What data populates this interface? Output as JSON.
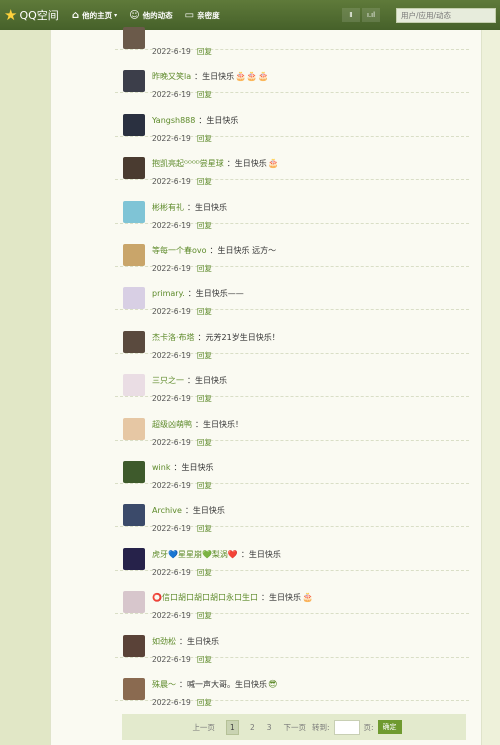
{
  "topbar": {
    "logo": "QQ空间",
    "nav": [
      "他的主页",
      "他的动态",
      "亲密度"
    ],
    "nav_caret": "▾",
    "btn1": "Ⅱ",
    "btn2": "ı.ıl",
    "search_placeholder": "用户/应用/动态"
  },
  "comments": [
    {
      "name": "",
      "content": "",
      "date": "2022-6-19",
      "reply": "回复",
      "avatar_color": "#6b5a4a",
      "emojis": ""
    },
    {
      "name": "昨晚又笑la",
      "content": "：生日快乐",
      "date": "2022-6-19",
      "reply": "回复",
      "avatar_color": "#3c3e4a",
      "emojis": "🎂🎂🎂"
    },
    {
      "name": "Yangsh888",
      "content": "：生日快乐",
      "date": "2022-6-19",
      "reply": "回复",
      "avatar_color": "#2a3040",
      "emojis": ""
    },
    {
      "name": "抱凯亮起ᴳᴼᴼᴰ尝星球",
      "content": "：生日快乐",
      "date": "2022-6-19",
      "reply": "回复",
      "avatar_color": "#4a3b30",
      "emojis": "🎂"
    },
    {
      "name": "彬彬有礼",
      "content": "：生日快乐",
      "date": "2022-6-19",
      "reply": "回复",
      "avatar_color": "#7fc4d6",
      "emojis": ""
    },
    {
      "name": "等每一个春ovo",
      "content": "：生日快乐 远方～",
      "date": "2022-6-19",
      "reply": "回复",
      "avatar_color": "#c9a56a",
      "emojis": ""
    },
    {
      "name": "primary.",
      "content": "：生日快乐——",
      "date": "2022-6-19",
      "reply": "回复",
      "avatar_color": "#d8cfe4",
      "emojis": ""
    },
    {
      "name": "杰卡洛·布塔",
      "content": "：元芳21岁生日快乐！",
      "date": "2022-6-19",
      "reply": "回复",
      "avatar_color": "#5a4a3e",
      "emojis": ""
    },
    {
      "name": "三只之一",
      "content": "：生日快乐",
      "date": "2022-6-19",
      "reply": "回复",
      "avatar_color": "#eadde4",
      "emojis": ""
    },
    {
      "name": "超级凶萌鸭",
      "content": "：生日快乐！",
      "date": "2022-6-19",
      "reply": "回复",
      "avatar_color": "#e6c7a4",
      "emojis": ""
    },
    {
      "name": "wink",
      "content": "：生日快乐",
      "date": "2022-6-19",
      "reply": "回复",
      "avatar_color": "#3e5a2c",
      "emojis": ""
    },
    {
      "name": "Archive",
      "content": "：生日快乐",
      "date": "2022-6-19",
      "reply": "回复",
      "avatar_color": "#3b4a6a",
      "emojis": ""
    },
    {
      "name": "虎牙💙星星崩💚梨涡❤️",
      "content": "：生日快乐",
      "date": "2022-6-19",
      "reply": "回复",
      "avatar_color": "#26224a",
      "emojis": ""
    },
    {
      "name": "⭕信口胡口胡口胡口永口生口",
      "content": "：生日快乐",
      "date": "2022-6-19",
      "reply": "回复",
      "avatar_color": "#d7c6cc",
      "emojis": "🎂"
    },
    {
      "name": "如劲松",
      "content": "：生日快乐",
      "date": "2022-6-19",
      "reply": "回复",
      "avatar_color": "#5a4238",
      "emojis": ""
    },
    {
      "name": "殊晨～",
      "content": "：喊一声大哥。生日快乐",
      "date": "2022-6-19",
      "reply": "回复",
      "avatar_color": "#8a6a50",
      "emojis": "😎"
    }
  ],
  "pager": {
    "prev": "上一页",
    "pages": [
      "1",
      "2",
      "3"
    ],
    "next": "下一页",
    "goto": "转到:",
    "page_unit": "页:",
    "confirm": "确定"
  }
}
